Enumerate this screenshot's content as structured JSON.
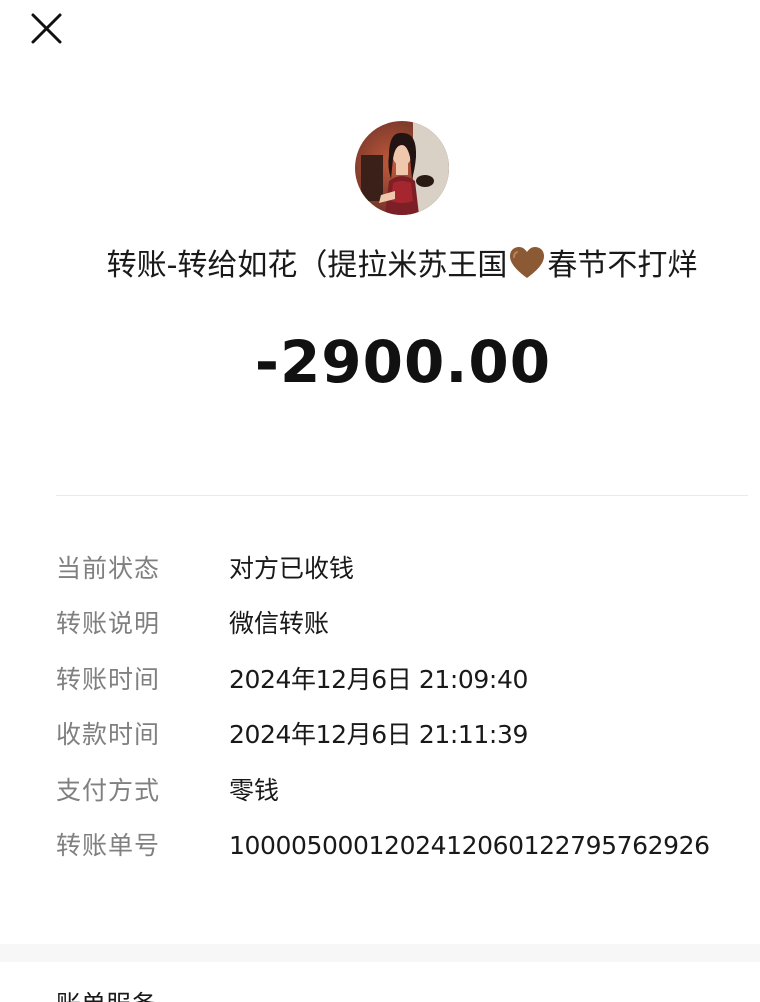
{
  "header": {
    "close_icon": "close-icon"
  },
  "payee": {
    "avatar_icon": "avatar",
    "title_prefix": "转账-转给如花（提拉米苏王国",
    "title_emoji": "brown-heart-icon",
    "title_suffix": "春节不打烊",
    "heart_color": "#8b5a34"
  },
  "amount": "-2900.00",
  "details": [
    {
      "label": "当前状态",
      "value": "对方已收钱"
    },
    {
      "label": "转账说明",
      "value": "微信转账"
    },
    {
      "label": "转账时间",
      "value": "2024年12月6日 21:09:40"
    },
    {
      "label": "收款时间",
      "value": "2024年12月6日 21:11:39"
    },
    {
      "label": "支付方式",
      "value": "零钱"
    },
    {
      "label": "转账单号",
      "value": "1000050001202412060122795762926"
    }
  ],
  "bottom_card": {
    "peek_text": "账单服务"
  },
  "colors": {
    "label_gray": "#808080",
    "text_dark": "#191919",
    "background": "#f7f7f7"
  }
}
